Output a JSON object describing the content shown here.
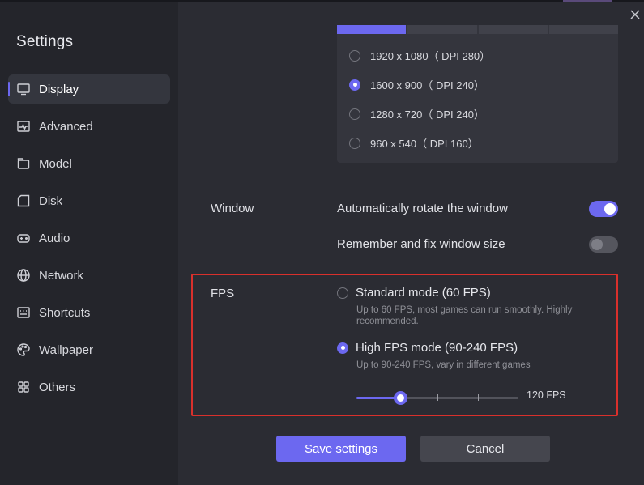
{
  "sidebar": {
    "title": "Settings",
    "items": [
      {
        "label": "Display",
        "icon": "monitor-icon"
      },
      {
        "label": "Advanced",
        "icon": "pulse-icon"
      },
      {
        "label": "Model",
        "icon": "model-icon"
      },
      {
        "label": "Disk",
        "icon": "disk-icon"
      },
      {
        "label": "Audio",
        "icon": "gamepad-icon"
      },
      {
        "label": "Network",
        "icon": "globe-icon"
      },
      {
        "label": "Shortcuts",
        "icon": "keyboard-icon"
      },
      {
        "label": "Wallpaper",
        "icon": "palette-icon"
      },
      {
        "label": "Others",
        "icon": "grid-icon"
      }
    ],
    "active_item": "Display"
  },
  "resolution": {
    "options": [
      {
        "label": "1920 x 1080（ DPI 280）",
        "selected": false
      },
      {
        "label": "1600 x 900（ DPI 240）",
        "selected": true
      },
      {
        "label": "1280 x 720（ DPI 240）",
        "selected": false
      },
      {
        "label": "960 x 540（ DPI 160）",
        "selected": false
      }
    ]
  },
  "window": {
    "label": "Window",
    "auto_rotate_label": "Automatically rotate the window",
    "auto_rotate_on": true,
    "remember_size_label": "Remember and fix window size",
    "remember_size_on": false
  },
  "fps": {
    "label": "FPS",
    "standard_title": "Standard mode (60 FPS)",
    "standard_desc": "Up to 60 FPS, most games can run smoothly. Highly recommended.",
    "standard_selected": false,
    "high_title": "High FPS mode (90-240 FPS)",
    "high_desc": "Up to 90-240 FPS, vary in different games",
    "high_selected": true,
    "slider_value_label": "120 FPS",
    "slider_fraction": 0.27
  },
  "buttons": {
    "save": "Save settings",
    "cancel": "Cancel"
  },
  "colors": {
    "accent": "#6c68f0",
    "highlight_border": "#d9302c"
  }
}
